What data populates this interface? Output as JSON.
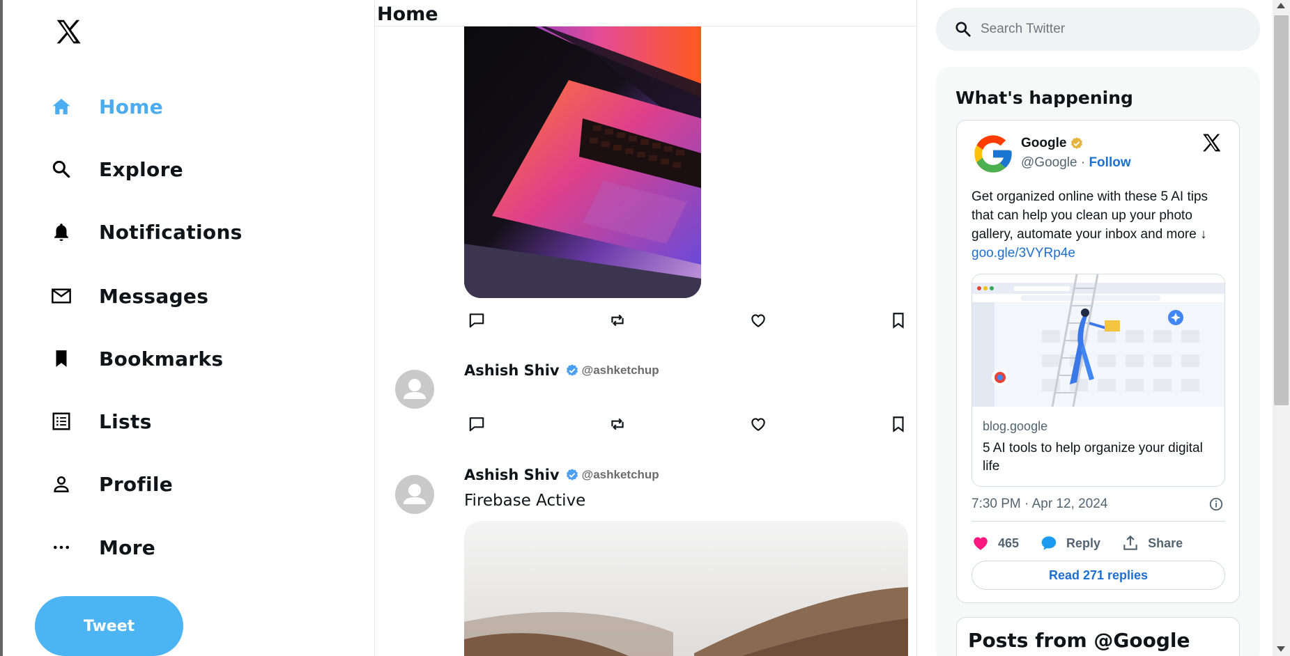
{
  "nav": {
    "items": [
      {
        "label": "Home",
        "icon": "home-icon"
      },
      {
        "label": "Explore",
        "icon": "search-icon"
      },
      {
        "label": "Notifications",
        "icon": "bell-icon"
      },
      {
        "label": "Messages",
        "icon": "mail-icon"
      },
      {
        "label": "Bookmarks",
        "icon": "bookmark-icon"
      },
      {
        "label": "Lists",
        "icon": "list-icon"
      },
      {
        "label": "Profile",
        "icon": "person-icon"
      },
      {
        "label": "More",
        "icon": "more-icon"
      }
    ],
    "tweet_label": "Tweet"
  },
  "feed": {
    "title": "Home",
    "posts": [
      {
        "name": "Ashish Shiv",
        "handle": "@ashketchup",
        "text": ""
      },
      {
        "name": "Ashish Shiv",
        "handle": "@ashketchup",
        "text": "Firebase Active"
      }
    ]
  },
  "search": {
    "placeholder": "Search Twitter"
  },
  "sidebar": {
    "title": "What's happening",
    "embed": {
      "name": "Google",
      "handle": "@Google",
      "separator": " · ",
      "follow": "Follow",
      "text": "Get organized online with these 5 AI tips that can help you clean up your photo gallery, automate your inbox and more ↓",
      "link": "goo.gle/3VYRp4e",
      "card_domain": "blog.google",
      "card_title": "5 AI tools to help organize your digital life",
      "time": "7:30 PM · Apr 12, 2024",
      "likes": "465",
      "reply": "Reply",
      "share": "Share",
      "read_replies": "Read 271 replies"
    },
    "posts_from": "Posts from @Google"
  },
  "colors": {
    "accent": "#4cacef",
    "tweet_button": "#4cb4f2",
    "link": "#1d6fd0",
    "like": "#f91880"
  }
}
